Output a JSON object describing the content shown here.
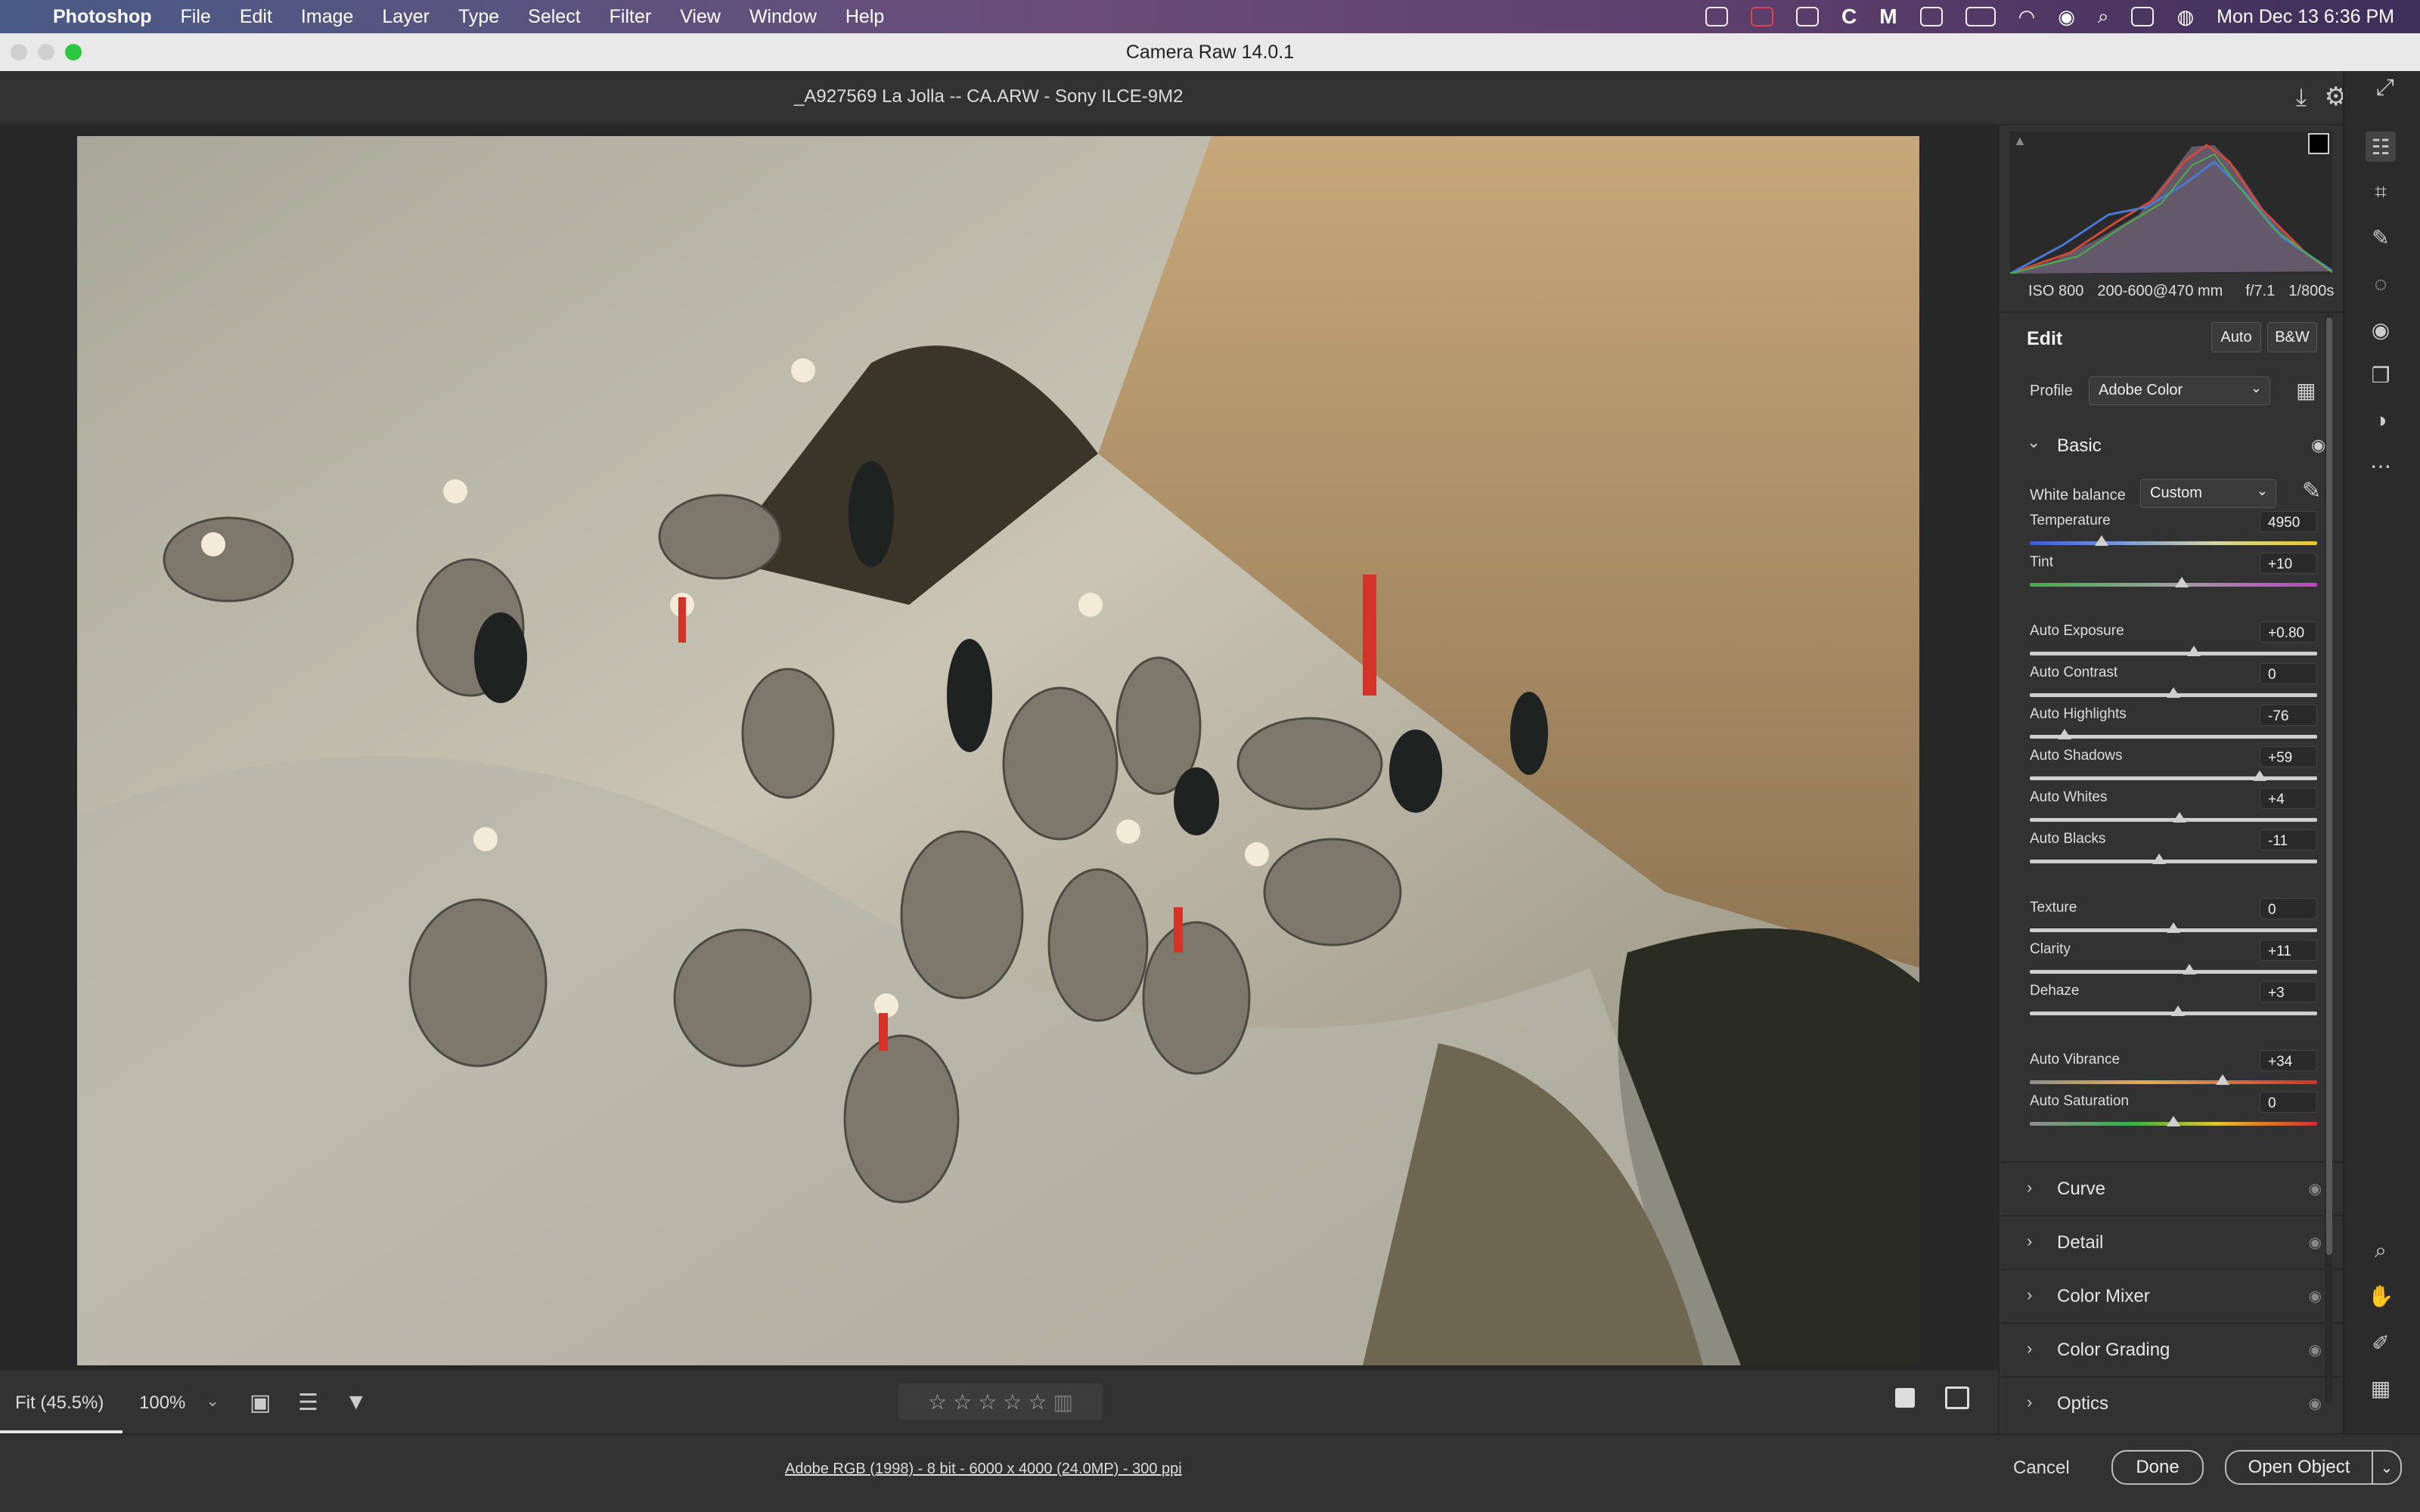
{
  "menubar": {
    "app_name": "Photoshop",
    "items": [
      "File",
      "Edit",
      "Image",
      "Layer",
      "Type",
      "Select",
      "Filter",
      "View",
      "Window",
      "Help"
    ],
    "datetime": "Mon Dec 13  6:36 PM"
  },
  "window": {
    "title": "Camera Raw 14.0.1"
  },
  "document": {
    "filename": "_A927569  La Jolla -- CA.ARW  -  Sony ILCE-9M2"
  },
  "camera_info": {
    "iso": "ISO 800",
    "lens": "200-600@470 mm",
    "aperture": "f/7.1",
    "shutter": "1/800s"
  },
  "edit": {
    "title": "Edit",
    "auto_label": "Auto",
    "bw_label": "B&W",
    "profile_label": "Profile",
    "profile_value": "Adobe Color"
  },
  "basic": {
    "title": "Basic",
    "white_balance_label": "White balance",
    "white_balance_value": "Custom",
    "sliders": [
      {
        "label": "Temperature",
        "value": "4950",
        "pos": 0.25
      },
      {
        "label": "Tint",
        "value": "+10",
        "pos": 0.53
      },
      {
        "label": "Auto Exposure",
        "value": "+0.80",
        "pos": 0.57
      },
      {
        "label": "Auto Contrast",
        "value": "0",
        "pos": 0.5
      },
      {
        "label": "Auto Highlights",
        "value": "-76",
        "pos": 0.12
      },
      {
        "label": "Auto Shadows",
        "value": "+59",
        "pos": 0.8
      },
      {
        "label": "Auto Whites",
        "value": "+4",
        "pos": 0.52
      },
      {
        "label": "Auto Blacks",
        "value": "-11",
        "pos": 0.45
      },
      {
        "label": "Texture",
        "value": "0",
        "pos": 0.5
      },
      {
        "label": "Clarity",
        "value": "+11",
        "pos": 0.555
      },
      {
        "label": "Dehaze",
        "value": "+3",
        "pos": 0.515
      },
      {
        "label": "Auto Vibrance",
        "value": "+34",
        "pos": 0.67
      },
      {
        "label": "Auto Saturation",
        "value": "0",
        "pos": 0.5
      }
    ]
  },
  "sections": [
    "Curve",
    "Detail",
    "Color Mixer",
    "Color Grading",
    "Optics"
  ],
  "bottombar": {
    "fit_label": "Fit (45.5%)",
    "zoom_value": "100%"
  },
  "status": {
    "info_link": "Adobe RGB (1998) - 8 bit - 6000 x 4000 (24.0MP) - 300 ppi"
  },
  "actions": {
    "cancel": "Cancel",
    "done": "Done",
    "open": "Open Object"
  },
  "colors": {
    "accent": "#3b82f6",
    "panel_bg": "#323232",
    "canvas_bg": "#272727"
  }
}
